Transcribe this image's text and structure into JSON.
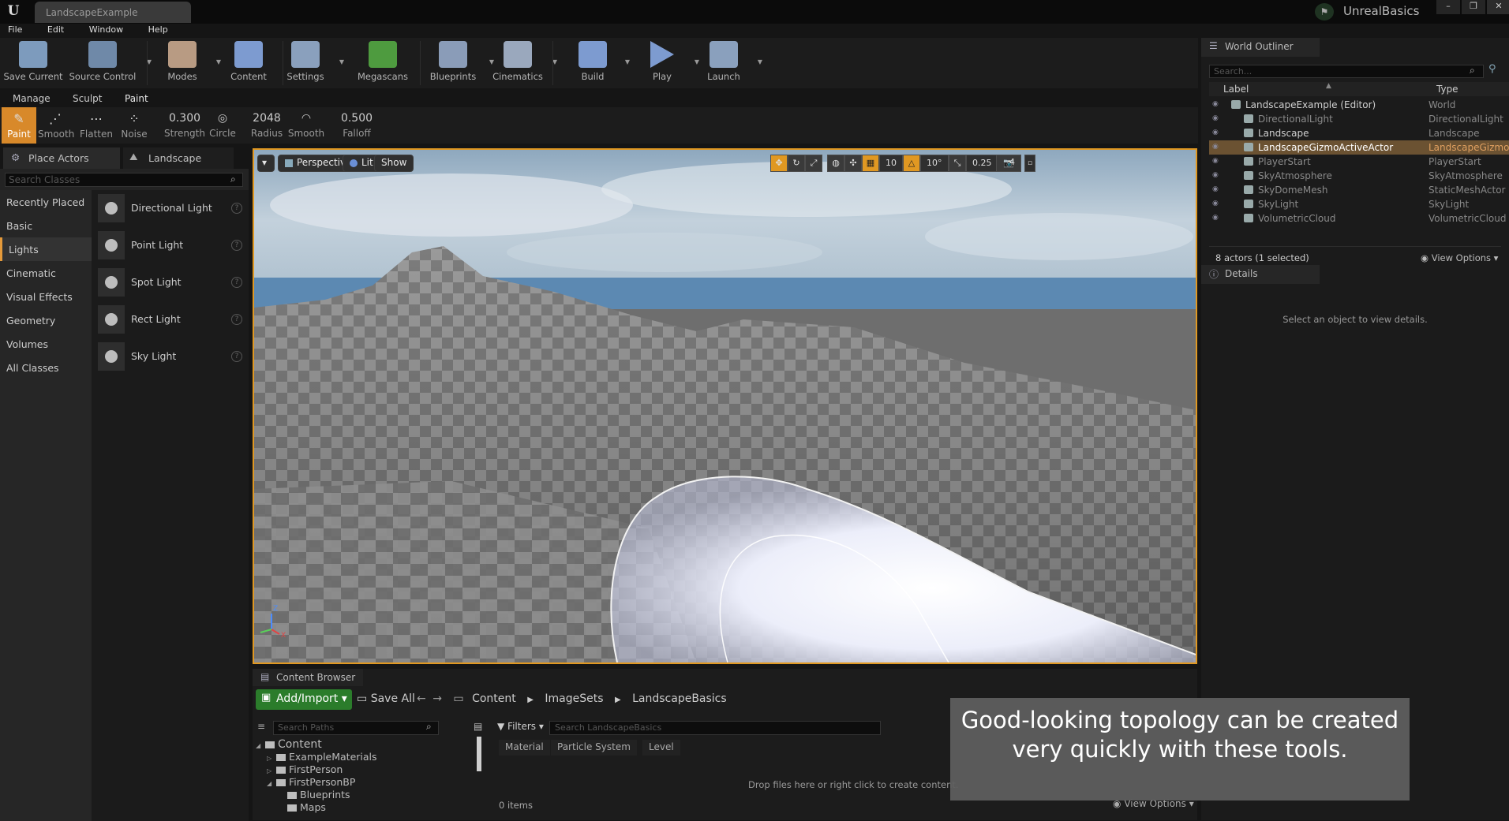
{
  "window": {
    "doc_tab": "LandscapeExample",
    "project": "UnrealBasics",
    "logo": "U",
    "win_buttons": [
      "–",
      "❐",
      "✕"
    ]
  },
  "menu": [
    "File",
    "Edit",
    "Window",
    "Help"
  ],
  "toolbar": {
    "buttons": [
      {
        "label": "Save Current",
        "icon": "save-icon",
        "color": "#7d9bbd"
      },
      {
        "label": "Source Control",
        "icon": "source-control-icon",
        "color": "#6f89a8"
      },
      {
        "label": "Modes",
        "icon": "modes-icon",
        "color": "#b89b83"
      },
      {
        "label": "Content",
        "icon": "content-icon",
        "color": "#7d9bd0"
      },
      {
        "label": "Settings",
        "icon": "settings-icon",
        "color": "#8aa0bd"
      },
      {
        "label": "Megascans",
        "icon": "megascans-icon",
        "color": "#4e9b3f"
      },
      {
        "label": "Blueprints",
        "icon": "blueprints-icon",
        "color": "#8a9cb8"
      },
      {
        "label": "Cinematics",
        "icon": "cinematics-icon",
        "color": "#9aa8bd"
      },
      {
        "label": "Build",
        "icon": "build-icon",
        "color": "#7d9bd0"
      },
      {
        "label": "Play",
        "icon": "play-icon",
        "color": "#7d9bd0"
      },
      {
        "label": "Launch",
        "icon": "launch-icon",
        "color": "#8aa0bd"
      }
    ]
  },
  "landscape_mode": {
    "tabs": [
      "Manage",
      "Sculpt",
      "Paint"
    ],
    "tools": [
      {
        "label": "Paint",
        "glyph": "✎"
      },
      {
        "label": "Smooth",
        "glyph": "⋰"
      },
      {
        "label": "Flatten",
        "glyph": "⋯"
      },
      {
        "label": "Noise",
        "glyph": "⁘"
      }
    ],
    "params": [
      {
        "value": "0.300",
        "label": "Strength"
      },
      {
        "value": "◎",
        "label": "Circle"
      },
      {
        "value": "2048",
        "label": "Radius"
      },
      {
        "value": "◠",
        "label": "Smooth"
      },
      {
        "value": "0.500",
        "label": "Falloff"
      }
    ]
  },
  "place_actors": {
    "tab1": "Place Actors",
    "tab2": "Landscape",
    "search_placeholder": "Search Classes",
    "categories": [
      "Recently Placed",
      "Basic",
      "Lights",
      "Cinematic",
      "Visual Effects",
      "Geometry",
      "Volumes",
      "All Classes"
    ],
    "selected_category": "Lights",
    "items": [
      {
        "label": "Directional Light",
        "icon": "directional-light-icon"
      },
      {
        "label": "Point Light",
        "icon": "point-light-icon"
      },
      {
        "label": "Spot Light",
        "icon": "spot-light-icon"
      },
      {
        "label": "Rect Light",
        "icon": "rect-light-icon"
      },
      {
        "label": "Sky Light",
        "icon": "sky-light-icon"
      }
    ],
    "help": "?"
  },
  "viewport": {
    "menu_caret": "▾",
    "perspective": "Perspective",
    "lit": "Lit",
    "show": "Show",
    "grid_snap": "10",
    "rotation_snap": "10°",
    "scale_snap": "0.25",
    "camera_speed": "4",
    "axis_labels": {
      "z": "Z",
      "x": "X"
    }
  },
  "content_browser": {
    "tab": "Content Browser",
    "add_import": "Add/Import",
    "save_all": "Save All",
    "breadcrumbs": [
      "Content",
      "ImageSets",
      "LandscapeBasics"
    ],
    "path_search_placeholder": "Search Paths",
    "tree": [
      {
        "label": "Content",
        "indent": 0,
        "arrow": "◢"
      },
      {
        "label": "ExampleMaterials",
        "indent": 1,
        "arrow": "▷"
      },
      {
        "label": "FirstPerson",
        "indent": 1,
        "arrow": "▷"
      },
      {
        "label": "FirstPersonBP",
        "indent": 1,
        "arrow": "◢"
      },
      {
        "label": "Blueprints",
        "indent": 2,
        "arrow": ""
      },
      {
        "label": "Maps",
        "indent": 2,
        "arrow": ""
      }
    ],
    "filters": "Filters",
    "asset_search_placeholder": "Search LandscapeBasics",
    "filter_tags": [
      "Material",
      "Particle System",
      "Level"
    ],
    "drop_hint": "Drop files here or right click to create content.",
    "items_count": "0 items",
    "view_options": "View Options"
  },
  "world_outliner": {
    "tab": "World Outliner",
    "search_placeholder": "Search...",
    "col_label": "Label",
    "col_type": "Type",
    "rows": [
      {
        "label": "LandscapeExample (Editor)",
        "type": "World",
        "indent": 0,
        "selected": false,
        "dim": false
      },
      {
        "label": "DirectionalLight",
        "type": "DirectionalLight",
        "indent": 1,
        "selected": false,
        "dim": true
      },
      {
        "label": "Landscape",
        "type": "Landscape",
        "indent": 1,
        "selected": false,
        "dim": false
      },
      {
        "label": "LandscapeGizmoActiveActor",
        "type": "LandscapeGizmoA",
        "indent": 1,
        "selected": true,
        "dim": false
      },
      {
        "label": "PlayerStart",
        "type": "PlayerStart",
        "indent": 1,
        "selected": false,
        "dim": true
      },
      {
        "label": "SkyAtmosphere",
        "type": "SkyAtmosphere",
        "indent": 1,
        "selected": false,
        "dim": true
      },
      {
        "label": "SkyDomeMesh",
        "type": "StaticMeshActor",
        "indent": 1,
        "selected": false,
        "dim": true
      },
      {
        "label": "SkyLight",
        "type": "SkyLight",
        "indent": 1,
        "selected": false,
        "dim": true
      },
      {
        "label": "VolumetricCloud",
        "type": "VolumetricCloud",
        "indent": 1,
        "selected": false,
        "dim": true
      }
    ],
    "actors_count": "8 actors (1 selected)",
    "view_options": "View Options"
  },
  "details": {
    "tab": "Details",
    "message": "Select an object to view details."
  },
  "caption": "Good-looking topology can be created very quickly with these tools.",
  "colors": {
    "accent": "#e09822",
    "add_import": "#2b7c2b",
    "selected_row": "#6b5232"
  }
}
